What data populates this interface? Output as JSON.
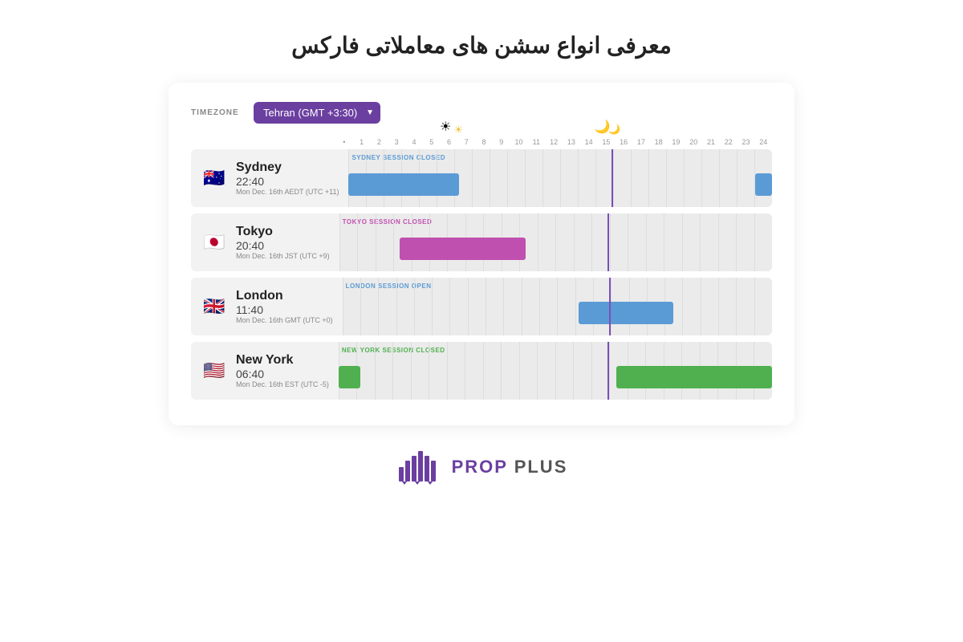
{
  "title": "معرفی انواع سشن های معاملاتی فارکس",
  "timezone_label": "TIMEZONE",
  "timezone_value": "Tehran (GMT +3:30)",
  "hours": [
    "•",
    "1",
    "2",
    "3",
    "4",
    "5",
    "6",
    "7",
    "8",
    "9",
    "10",
    "11",
    "12",
    "13",
    "14",
    "15",
    "16",
    "17",
    "18",
    "19",
    "20",
    "21",
    "22",
    "23",
    "24"
  ],
  "sessions": [
    {
      "city": "Sydney",
      "time": "22:40",
      "date": "Mon Dec. 16th AEDT (UTC +11)",
      "flag": "🇦🇺",
      "label": "SYDNEY SESSION CLOSED",
      "label_color": "#5b9bd5",
      "bar_color": "#5b9bd5",
      "bar_start_pct": 0,
      "bar_end_pct": 26,
      "bar2_start_pct": 96,
      "bar2_end_pct": 100
    },
    {
      "city": "Tokyo",
      "time": "20:40",
      "date": "Mon Dec. 16th JST (UTC +9)",
      "flag": "🇯🇵",
      "label": "TOKYO SESSION CLOSED",
      "label_color": "#c050b0",
      "bar_color": "#c050b0",
      "bar_start_pct": 14,
      "bar_end_pct": 43,
      "bar2_start_pct": null,
      "bar2_end_pct": null
    },
    {
      "city": "London",
      "time": "11:40",
      "date": "Mon Dec. 16th GMT (UTC +0)",
      "flag": "🇬🇧",
      "label": "LONDON SESSION OPEN",
      "label_color": "#5b9bd5",
      "bar_color": "#5b9bd5",
      "bar_start_pct": 55,
      "bar_end_pct": 77,
      "bar2_start_pct": null,
      "bar2_end_pct": null
    },
    {
      "city": "New York",
      "time": "06:40",
      "date": "Mon Dec. 16th EST (UTC -5)",
      "flag": "🇺🇸",
      "label": "NEW YORK SESSION CLOSED",
      "label_color": "#50b050",
      "bar_color": "#50b050",
      "bar_start_pct": 0,
      "bar_end_pct": 5,
      "bar2_start_pct": 64,
      "bar2_end_pct": 100
    }
  ],
  "current_time_pct": 62,
  "footer": {
    "logo_text": "PROP PLUS"
  }
}
